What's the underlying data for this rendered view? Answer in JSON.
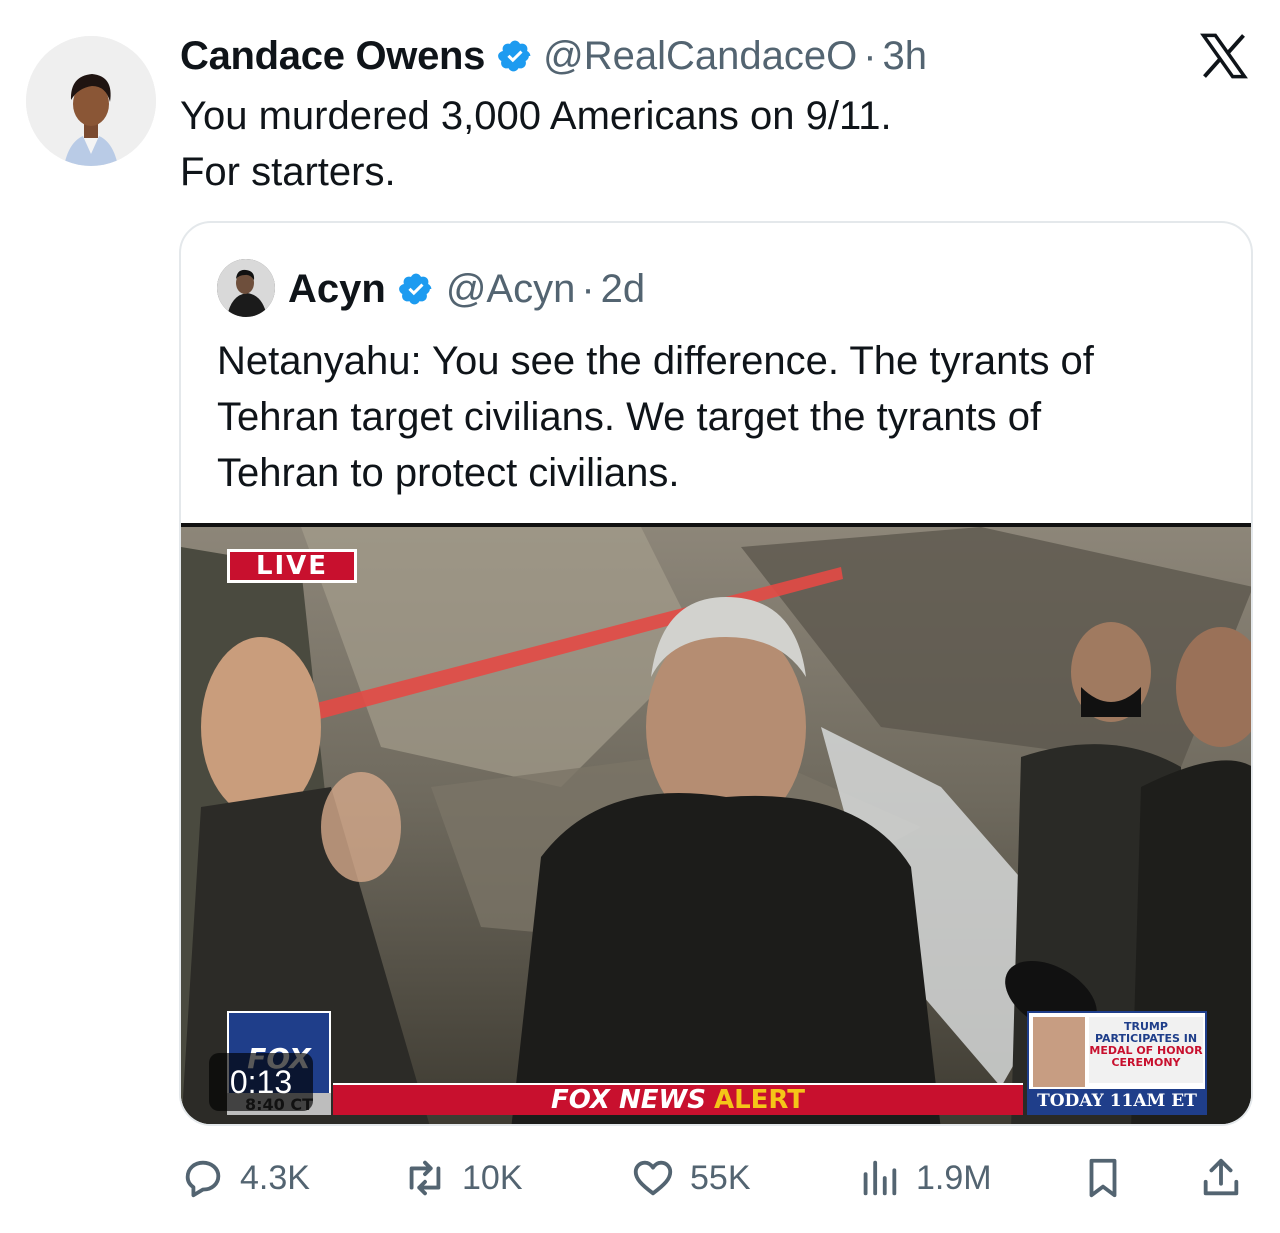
{
  "tweet": {
    "author_name": "Candace Owens",
    "handle": "@RealCandaceO",
    "separator": "·",
    "time": "3h",
    "text_lines": [
      "You murdered 3,000 Americans on 9/11.",
      "For starters."
    ]
  },
  "quoted_tweet": {
    "author_name": "Acyn",
    "handle": "@Acyn",
    "separator": "·",
    "time": "2d",
    "text_lines": [
      "Netanyahu: You see the difference. The tyrants of",
      "Tehran target civilians. We target the tyrants of",
      "Tehran to protect civilians."
    ],
    "video": {
      "timer": "0:13",
      "live_label": "LIVE",
      "logo_text": "FOX",
      "clock": "8:40 CT",
      "ticker_brand": "FOX NEWS",
      "ticker_alert": "ALERT",
      "side_box_lines": [
        "TRUMP",
        "PARTICIPATES IN"
      ],
      "side_box_red_lines": [
        "MEDAL OF HONOR",
        "CEREMONY"
      ],
      "side_box_bottom": "TODAY 11AM ET"
    }
  },
  "actions": {
    "replies": "4.3K",
    "reposts": "10K",
    "likes": "55K",
    "views": "1.9M"
  },
  "icons": {
    "verified": "verified-badge-icon",
    "platform": "x-logo-icon",
    "reply": "reply-icon",
    "repost": "repost-icon",
    "like": "heart-icon",
    "views": "views-icon",
    "bookmark": "bookmark-icon",
    "share": "share-icon"
  },
  "colors": {
    "text": "#0f1419",
    "secondary": "#536471",
    "verified": "#1d9bf0",
    "fox_red": "#c8102e",
    "fox_blue": "#1f3e8a"
  }
}
